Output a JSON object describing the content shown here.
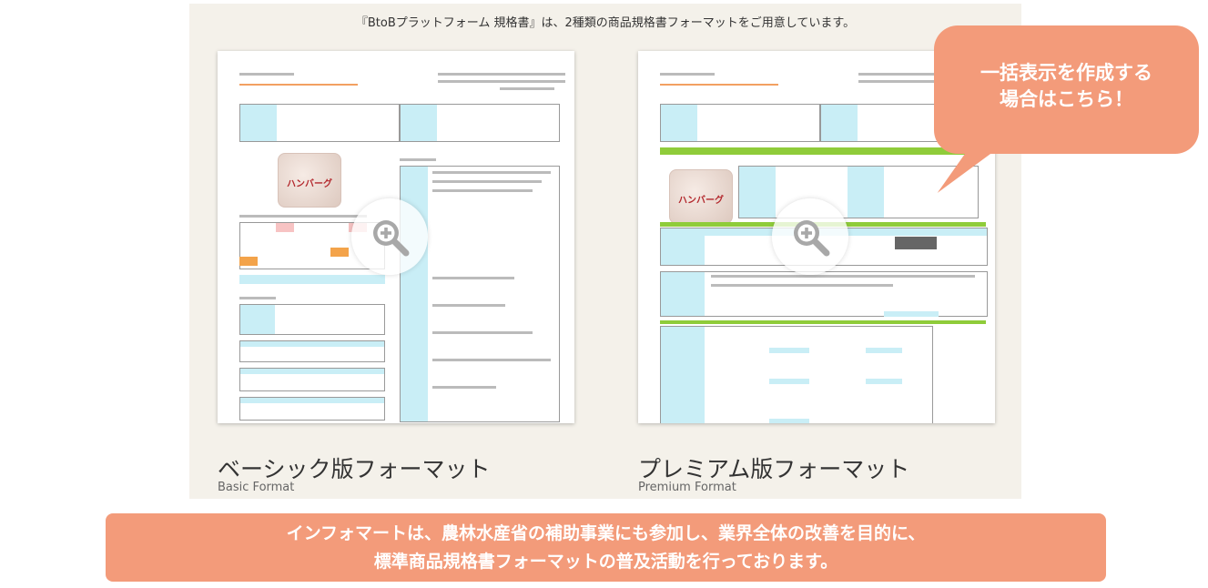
{
  "intro": "『BtoBプラットフォーム 規格書』は、2種類の商品規格書フォーマットをご用意しています。",
  "basic": {
    "title": "ベーシック版フォーマット",
    "subtitle": "Basic Format",
    "package_label": "ハンバーグ",
    "zoom_icon": "zoom-in-icon"
  },
  "premium": {
    "title": "プレミアム版フォーマット",
    "subtitle": "Premium Format",
    "package_label": "ハンバーグ",
    "zoom_icon": "zoom-in-icon"
  },
  "callout": {
    "line1": "一括表示を作成する",
    "line2": "場合はこちら！"
  },
  "banner": {
    "line1": "インフォマートは、農林水産省の補助事業にも参加し、業界全体の改善を目的に、",
    "line2": "標準商品規格書フォーマットの普及活動を行っております。"
  },
  "colors": {
    "accent": "#f39b7a",
    "panel": "#f4f1ea",
    "doc_cyan": "#c9eef6",
    "doc_green": "#8fcc3a"
  }
}
